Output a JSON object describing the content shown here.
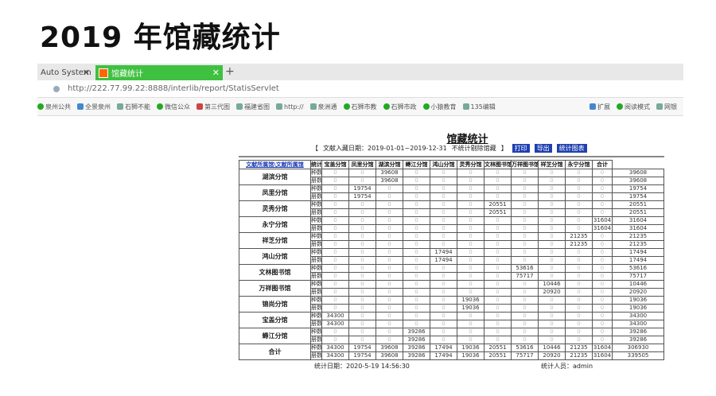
{
  "slide_title": "2019 年馆藏统计",
  "browser": {
    "tabs": [
      {
        "label": "Auto System",
        "active": false
      },
      {
        "label": "馆藏统计",
        "active": true
      }
    ],
    "new_tab": "+",
    "url": "http://222.77.99.22:8888/interlib/report/StatisServlet",
    "bookmarks": [
      "泉州公共",
      "全景泉州",
      "石狮不能",
      "微信公众",
      "第三代图",
      "福建省图",
      "http://",
      "泉洲通",
      "石狮市教",
      "石狮市政",
      "小猿教育",
      "135编辑",
      "扩展",
      "阅读模式",
      "网银"
    ]
  },
  "report": {
    "title": "馆藏统计",
    "filter_open": "【",
    "filter_label": "文献入藏日期：2019-01-01~2019-12-31",
    "filter_note": "不统计剔除馆藏",
    "filter_close": "】",
    "buttons": [
      "打印",
      "导出",
      "统计图表"
    ],
    "columns": [
      "文献所属馆\\文献所属馆",
      "统计",
      "宝盖分馆",
      "凤里分馆",
      "湖滨分馆",
      "蟳江分馆",
      "鸿山分馆",
      "灵秀分馆",
      "文林图书馆",
      "万祥图书馆",
      "祥芝分馆",
      "永宁分馆",
      "合计"
    ],
    "rows": [
      {
        "name": "湖滨分馆",
        "kinds": [
          "种数",
          "册数"
        ],
        "values": [
          [
            "0",
            "0",
            "39608",
            "0",
            "0",
            "0",
            "0",
            "0",
            "0",
            "0",
            "0",
            "39608"
          ],
          [
            "0",
            "0",
            "39608",
            "0",
            "0",
            "0",
            "0",
            "0",
            "0",
            "0",
            "0",
            "39608"
          ]
        ]
      },
      {
        "name": "凤里分馆",
        "kinds": [
          "种数",
          "册数"
        ],
        "values": [
          [
            "0",
            "19754",
            "0",
            "0",
            "0",
            "0",
            "0",
            "0",
            "0",
            "0",
            "0",
            "19754"
          ],
          [
            "0",
            "19754",
            "0",
            "0",
            "0",
            "0",
            "0",
            "0",
            "0",
            "0",
            "0",
            "19754"
          ]
        ]
      },
      {
        "name": "灵秀分馆",
        "kinds": [
          "种数",
          "册数"
        ],
        "values": [
          [
            "0",
            "0",
            "0",
            "0",
            "0",
            "0",
            "20551",
            "0",
            "0",
            "0",
            "0",
            "20551"
          ],
          [
            "0",
            "0",
            "0",
            "0",
            "0",
            "0",
            "20551",
            "0",
            "0",
            "0",
            "0",
            "20551"
          ]
        ]
      },
      {
        "name": "永宁分馆",
        "kinds": [
          "种数",
          "册数"
        ],
        "values": [
          [
            "0",
            "0",
            "0",
            "0",
            "0",
            "0",
            "0",
            "0",
            "0",
            "0",
            "31604",
            "31604"
          ],
          [
            "0",
            "0",
            "0",
            "0",
            "0",
            "0",
            "0",
            "0",
            "0",
            "0",
            "31604",
            "31604"
          ]
        ]
      },
      {
        "name": "祥芝分馆",
        "kinds": [
          "种数",
          "册数"
        ],
        "values": [
          [
            "0",
            "0",
            "0",
            "0",
            "0",
            "0",
            "0",
            "0",
            "0",
            "21235",
            "0",
            "21235"
          ],
          [
            "0",
            "0",
            "0",
            "0",
            "0",
            "0",
            "0",
            "0",
            "0",
            "21235",
            "0",
            "21235"
          ]
        ]
      },
      {
        "name": "鸿山分馆",
        "kinds": [
          "种数",
          "册数"
        ],
        "values": [
          [
            "0",
            "0",
            "0",
            "0",
            "17494",
            "0",
            "0",
            "0",
            "0",
            "0",
            "0",
            "17494"
          ],
          [
            "0",
            "0",
            "0",
            "0",
            "17494",
            "0",
            "0",
            "0",
            "0",
            "0",
            "0",
            "17494"
          ]
        ]
      },
      {
        "name": "文林图书馆",
        "kinds": [
          "种数",
          "册数"
        ],
        "values": [
          [
            "0",
            "0",
            "0",
            "0",
            "0",
            "0",
            "0",
            "53616",
            "0",
            "0",
            "0",
            "53616"
          ],
          [
            "0",
            "0",
            "0",
            "0",
            "0",
            "0",
            "0",
            "75717",
            "0",
            "0",
            "0",
            "75717"
          ]
        ]
      },
      {
        "name": "万祥图书馆",
        "kinds": [
          "种数",
          "册数"
        ],
        "values": [
          [
            "0",
            "0",
            "0",
            "0",
            "0",
            "0",
            "0",
            "0",
            "10446",
            "0",
            "0",
            "10446"
          ],
          [
            "0",
            "0",
            "0",
            "0",
            "0",
            "0",
            "0",
            "0",
            "20920",
            "0",
            "0",
            "20920"
          ]
        ]
      },
      {
        "name": "锦尚分馆",
        "kinds": [
          "种数",
          "册数"
        ],
        "values": [
          [
            "0",
            "0",
            "0",
            "0",
            "0",
            "19036",
            "0",
            "0",
            "0",
            "0",
            "0",
            "19036"
          ],
          [
            "0",
            "0",
            "0",
            "0",
            "0",
            "19036",
            "0",
            "0",
            "0",
            "0",
            "0",
            "19036"
          ]
        ]
      },
      {
        "name": "宝盖分馆",
        "kinds": [
          "种数",
          "册数"
        ],
        "values": [
          [
            "34300",
            "0",
            "0",
            "0",
            "0",
            "0",
            "0",
            "0",
            "0",
            "0",
            "0",
            "34300"
          ],
          [
            "34300",
            "0",
            "0",
            "0",
            "0",
            "0",
            "0",
            "0",
            "0",
            "0",
            "0",
            "34300"
          ]
        ]
      },
      {
        "name": "蟳江分馆",
        "kinds": [
          "种数",
          "册数"
        ],
        "values": [
          [
            "0",
            "0",
            "0",
            "39286",
            "0",
            "0",
            "0",
            "0",
            "0",
            "0",
            "0",
            "39286"
          ],
          [
            "0",
            "0",
            "0",
            "39286",
            "0",
            "0",
            "0",
            "0",
            "0",
            "0",
            "0",
            "39286"
          ]
        ]
      },
      {
        "name": "合计",
        "kinds": [
          "种数",
          "册数"
        ],
        "values": [
          [
            "34300",
            "19754",
            "39608",
            "39286",
            "17494",
            "19036",
            "20551",
            "53616",
            "10446",
            "21235",
            "31604",
            "306930"
          ],
          [
            "34300",
            "19754",
            "39608",
            "39286",
            "17494",
            "19036",
            "20551",
            "75717",
            "20920",
            "21235",
            "31604",
            "339505"
          ]
        ]
      }
    ],
    "stat_date": "统计日期：2020-5-19 14:56:30",
    "stat_person": "统计人员：admin"
  }
}
